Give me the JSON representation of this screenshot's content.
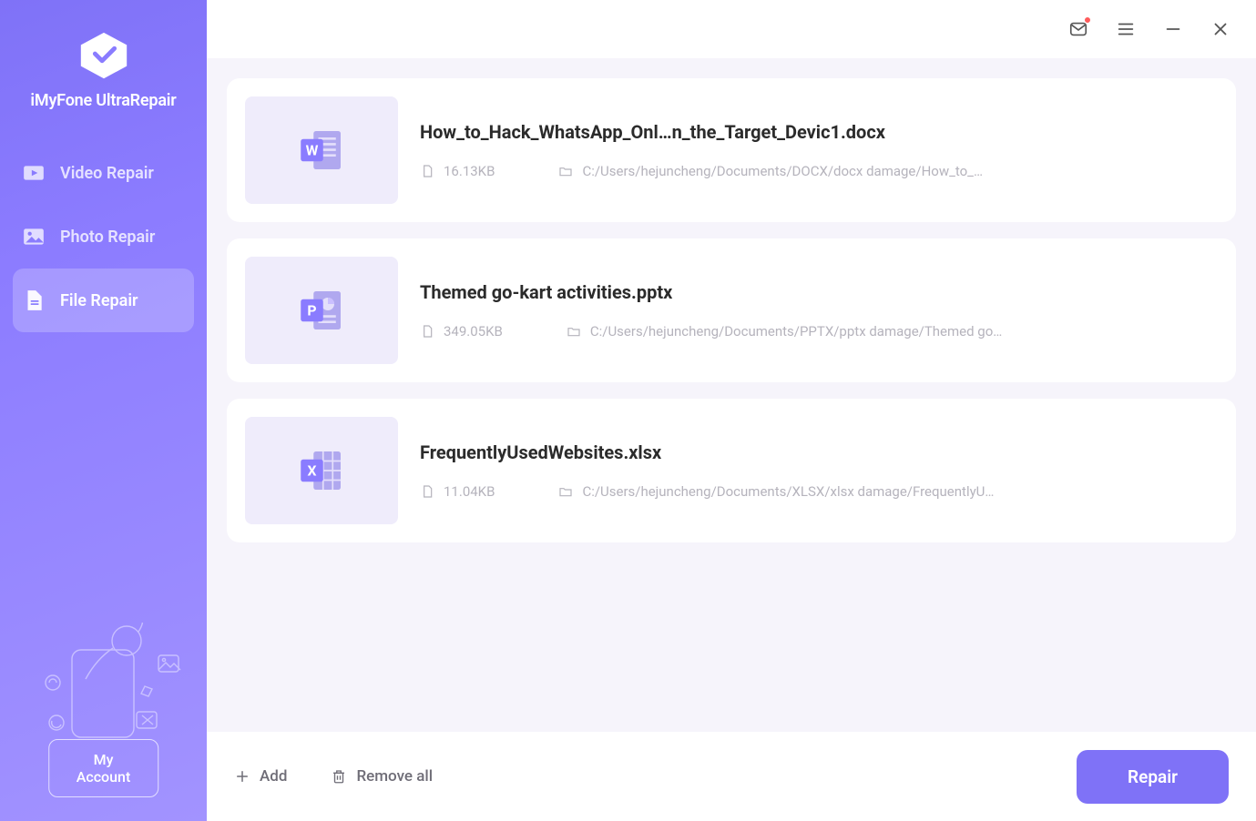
{
  "brand": {
    "name": "iMyFone UltraRepair"
  },
  "nav": {
    "items": [
      {
        "label": "Video Repair",
        "active": false,
        "icon": "video"
      },
      {
        "label": "Photo Repair",
        "active": false,
        "icon": "photo"
      },
      {
        "label": "File Repair",
        "active": true,
        "icon": "file"
      }
    ]
  },
  "account_btn": "My Account",
  "files": [
    {
      "name": "How_to_Hack_WhatsApp_Onl…n_the_Target_Devic1.docx",
      "size": "16.13KB",
      "path": "C:/Users/hejuncheng/Documents/DOCX/docx damage/How_to_…",
      "type": "word"
    },
    {
      "name": "Themed go-kart activities.pptx",
      "size": "349.05KB",
      "path": "C:/Users/hejuncheng/Documents/PPTX/pptx damage/Themed go…",
      "type": "powerpoint"
    },
    {
      "name": "FrequentlyUsedWebsites.xlsx",
      "size": "11.04KB",
      "path": "C:/Users/hejuncheng/Documents/XLSX/xlsx damage/FrequentlyU…",
      "type": "excel"
    }
  ],
  "footer": {
    "add": "Add",
    "remove_all": "Remove all",
    "repair": "Repair"
  }
}
